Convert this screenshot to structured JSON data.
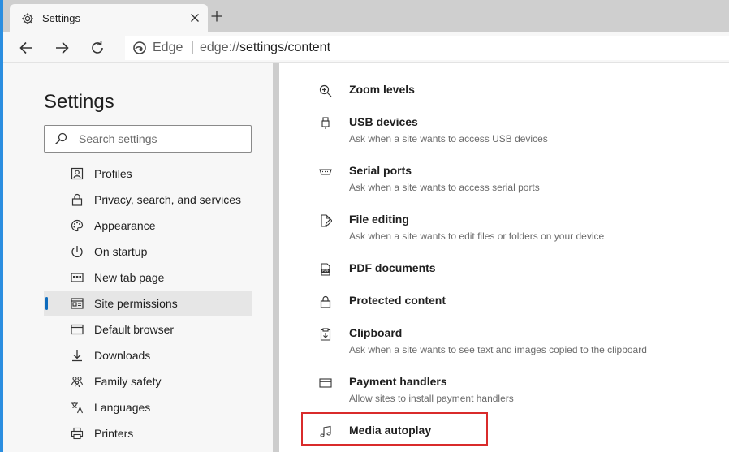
{
  "browser": {
    "tab": {
      "title": "Settings",
      "icon": "gear-icon",
      "close_icon": "close-icon"
    },
    "new_tab_icon": "plus-icon",
    "nav": {
      "back_icon": "arrow-left-icon",
      "forward_icon": "arrow-right-icon",
      "refresh_icon": "refresh-icon"
    },
    "address": {
      "brand": "Edge",
      "url_scheme": "edge://",
      "url_path": "settings/content"
    }
  },
  "sidebar": {
    "title": "Settings",
    "search_placeholder": "Search settings",
    "items": [
      {
        "label": "Profiles",
        "icon": "profile-icon",
        "selected": false
      },
      {
        "label": "Privacy, search, and services",
        "icon": "lock-icon",
        "selected": false
      },
      {
        "label": "Appearance",
        "icon": "palette-icon",
        "selected": false
      },
      {
        "label": "On startup",
        "icon": "power-icon",
        "selected": false
      },
      {
        "label": "New tab page",
        "icon": "new-tab-page-icon",
        "selected": false
      },
      {
        "label": "Site permissions",
        "icon": "site-permissions-icon",
        "selected": true
      },
      {
        "label": "Default browser",
        "icon": "browser-icon",
        "selected": false
      },
      {
        "label": "Downloads",
        "icon": "download-icon",
        "selected": false
      },
      {
        "label": "Family safety",
        "icon": "family-icon",
        "selected": false
      },
      {
        "label": "Languages",
        "icon": "languages-icon",
        "selected": false
      },
      {
        "label": "Printers",
        "icon": "printer-icon",
        "selected": false
      }
    ]
  },
  "permissions": [
    {
      "title": "Zoom levels",
      "description": "",
      "icon": "zoom-icon"
    },
    {
      "title": "USB devices",
      "description": "Ask when a site wants to access USB devices",
      "icon": "usb-icon"
    },
    {
      "title": "Serial ports",
      "description": "Ask when a site wants to access serial ports",
      "icon": "serial-port-icon"
    },
    {
      "title": "File editing",
      "description": "Ask when a site wants to edit files or folders on your device",
      "icon": "file-edit-icon"
    },
    {
      "title": "PDF documents",
      "description": "",
      "icon": "pdf-icon"
    },
    {
      "title": "Protected content",
      "description": "",
      "icon": "lock-icon"
    },
    {
      "title": "Clipboard",
      "description": "Ask when a site wants to see text and images copied to the clipboard",
      "icon": "clipboard-icon"
    },
    {
      "title": "Payment handlers",
      "description": "Allow sites to install payment handlers",
      "icon": "payment-card-icon"
    },
    {
      "title": "Media autoplay",
      "description": "",
      "icon": "music-note-icon"
    }
  ],
  "colors": {
    "accent": "#0f6cbd",
    "highlight_box": "#d92b2b",
    "window_edge": "#2b8ee0"
  }
}
